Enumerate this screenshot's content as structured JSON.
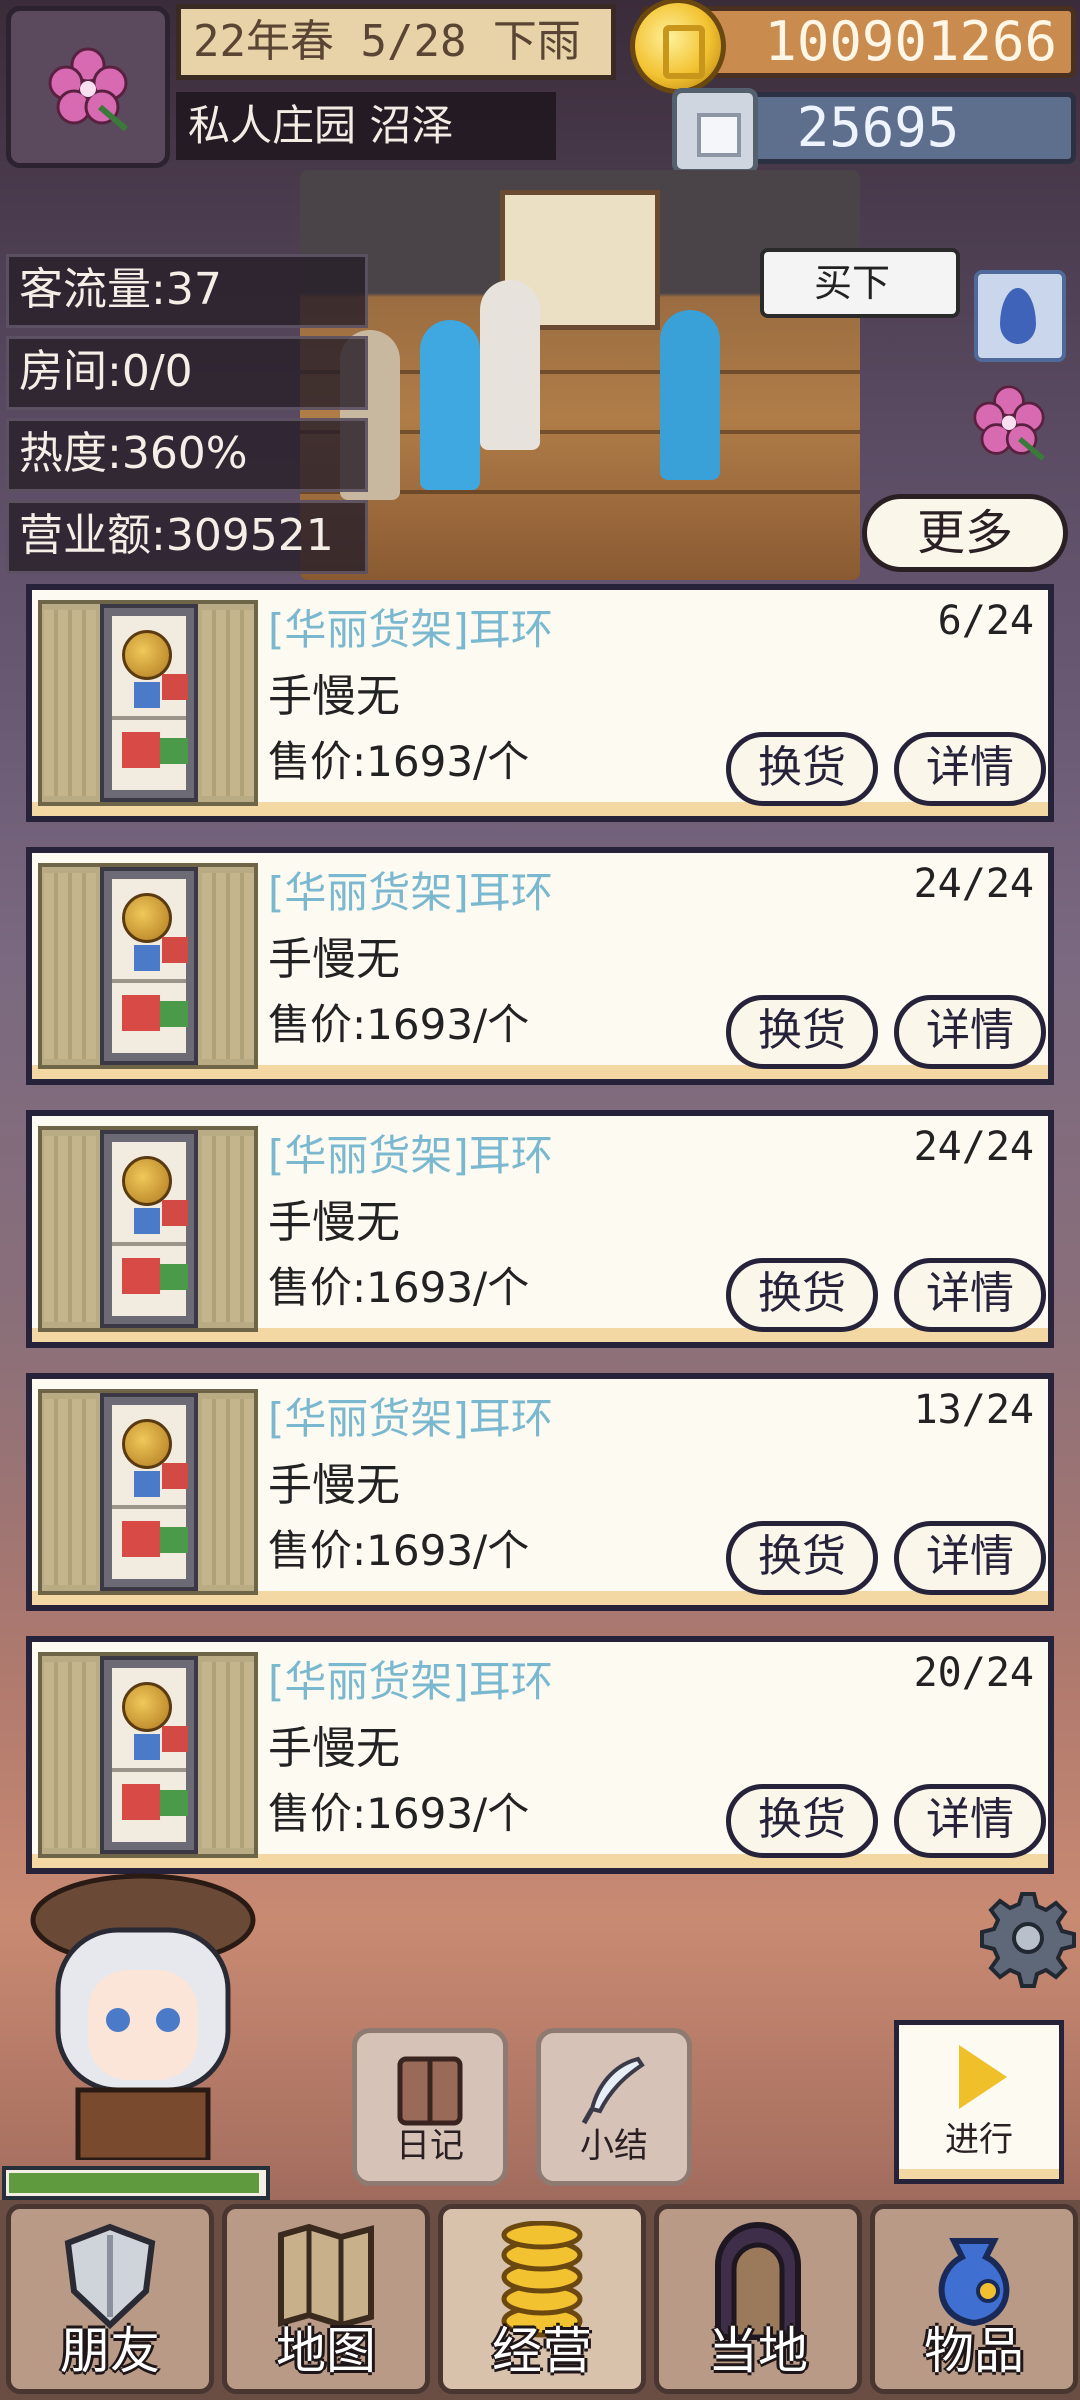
{
  "hud": {
    "date_weather": "22年春 5/28 下雨",
    "location": "私人庄园 沼泽",
    "gold": "100901266",
    "gems": "25695"
  },
  "stats": {
    "traffic": "客流量:37",
    "rooms": "房间:0/0",
    "popularity": "热度:360%",
    "revenue": "营业额:309521"
  },
  "scene": {
    "bubble_text": "买下"
  },
  "more_button_label": "更多",
  "shelves": [
    {
      "title": "[华丽货架]耳环",
      "count": "6/24",
      "owner": "手慢无",
      "price": "售价:1693/个",
      "swap_label": "换货",
      "detail_label": "详情"
    },
    {
      "title": "[华丽货架]耳环",
      "count": "24/24",
      "owner": "手慢无",
      "price": "售价:1693/个",
      "swap_label": "换货",
      "detail_label": "详情"
    },
    {
      "title": "[华丽货架]耳环",
      "count": "24/24",
      "owner": "手慢无",
      "price": "售价:1693/个",
      "swap_label": "换货",
      "detail_label": "详情"
    },
    {
      "title": "[华丽货架]耳环",
      "count": "13/24",
      "owner": "手慢无",
      "price": "售价:1693/个",
      "swap_label": "换货",
      "detail_label": "详情"
    },
    {
      "title": "[华丽货架]耳环",
      "count": "20/24",
      "owner": "手慢无",
      "price": "售价:1693/个",
      "swap_label": "换货",
      "detail_label": "详情"
    }
  ],
  "actions": {
    "diary_label": "日记",
    "summary_label": "小结",
    "proceed_label": "进行"
  },
  "player": {
    "hp_fraction": 0.96
  },
  "nav": [
    {
      "label": "朋友",
      "icon": "shield-icon",
      "active": false
    },
    {
      "label": "地图",
      "icon": "map-icon",
      "active": false
    },
    {
      "label": "经营",
      "icon": "coins-icon",
      "active": true
    },
    {
      "label": "当地",
      "icon": "door-icon",
      "active": false
    },
    {
      "label": "物品",
      "icon": "bag-icon",
      "active": false
    }
  ],
  "colors": {
    "title_blue": "#7ab8d0",
    "panel_border": "#25223a",
    "hp_green": "#5f9a3e",
    "coin_gold": "#f2c230"
  }
}
